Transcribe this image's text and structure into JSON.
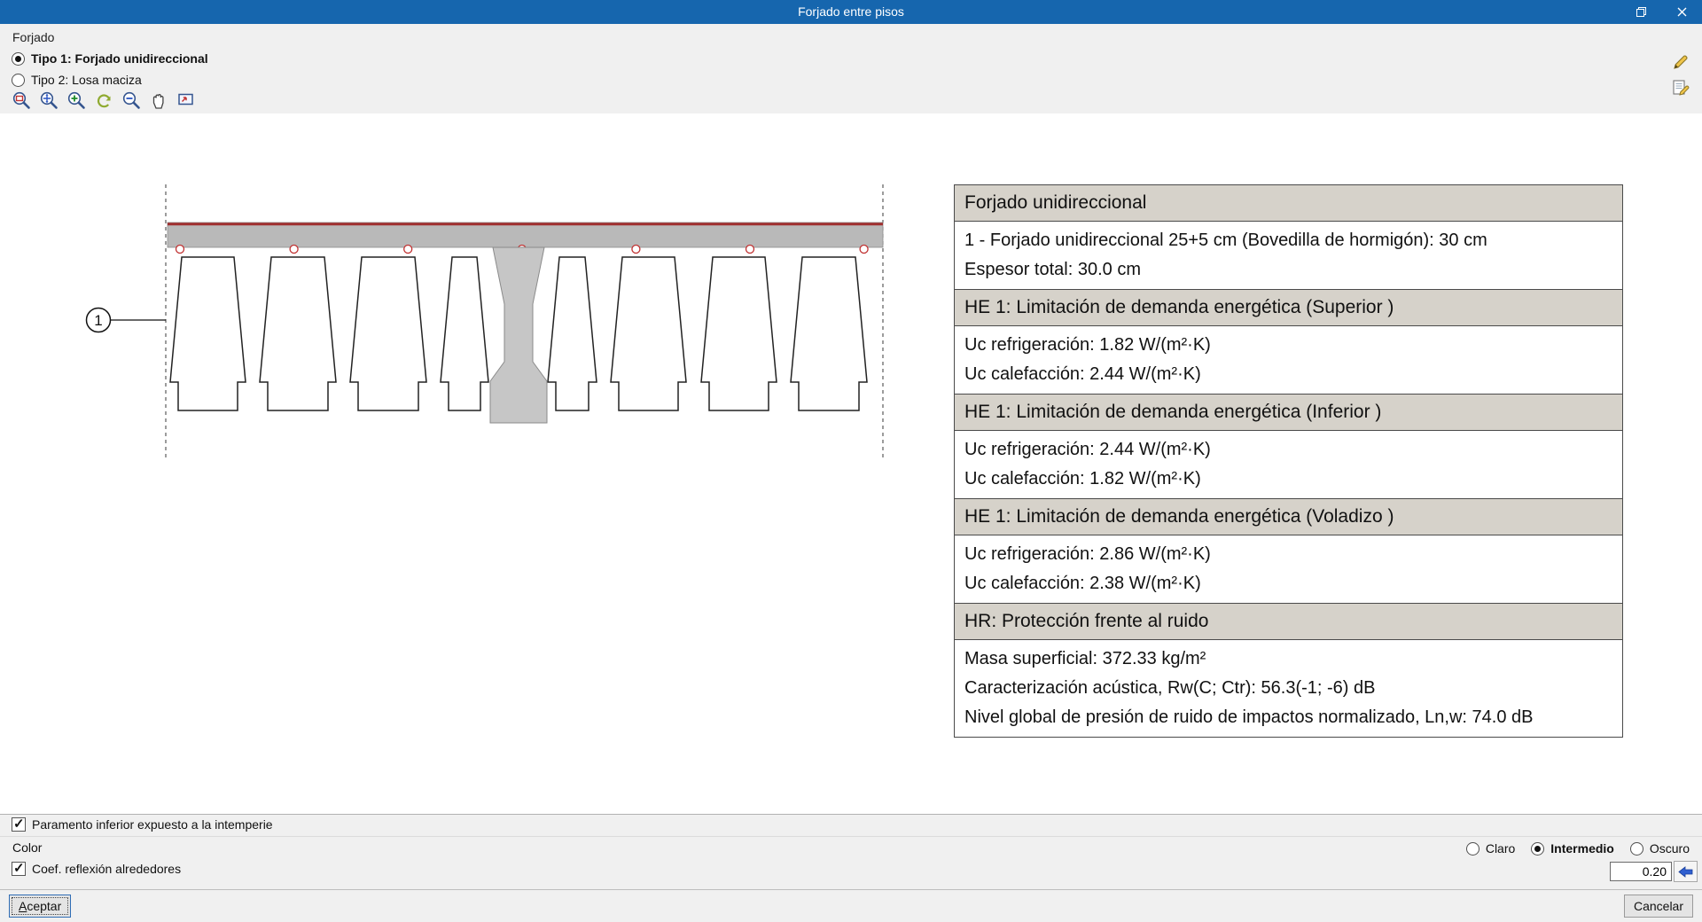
{
  "window": {
    "title": "Forjado entre pisos"
  },
  "titlebar": {
    "controls": [
      {
        "icon": "restore-icon"
      },
      {
        "icon": "close-icon"
      }
    ]
  },
  "top_panel": {
    "group_label": "Forjado",
    "options": [
      {
        "label": "Tipo 1: Forjado unidireccional",
        "selected": true
      },
      {
        "label": "Tipo 2: Losa maciza",
        "selected": false
      }
    ],
    "edit_buttons": [
      {
        "icon": "pencil-icon"
      },
      {
        "icon": "pencil-paper-icon"
      }
    ]
  },
  "toolbar": {
    "icons": [
      "zoom-window-icon",
      "zoom-extents-icon",
      "zoom-in-icon",
      "redraw-icon",
      "zoom-previous-icon",
      "pan-icon",
      "fit-view-icon"
    ]
  },
  "drawing": {
    "callout_label": "1"
  },
  "info_table": {
    "sections": [
      {
        "header": "Forjado unidireccional",
        "lines": [
          "1 - Forjado unidireccional 25+5 cm (Bovedilla de hormigón): 30 cm",
          "Espesor total: 30.0 cm"
        ]
      },
      {
        "header": "HE 1: Limitación de demanda energética (Superior )",
        "lines": [
          "Uc refrigeración: 1.82 W/(m²·K)",
          "Uc calefacción: 2.44 W/(m²·K)"
        ]
      },
      {
        "header": "HE 1: Limitación de demanda energética (Inferior )",
        "lines": [
          "Uc refrigeración: 2.44 W/(m²·K)",
          "Uc calefacción: 1.82 W/(m²·K)"
        ]
      },
      {
        "header": "HE 1: Limitación de demanda energética (Voladizo )",
        "lines": [
          "Uc refrigeración: 2.86 W/(m²·K)",
          "Uc calefacción: 2.38 W/(m²·K)"
        ]
      },
      {
        "header": "HR: Protección frente al ruido",
        "lines": [
          "Masa superficial: 372.33 kg/m²",
          "Caracterización acústica, Rw(C; Ctr): 56.3(-1; -6) dB",
          "Nivel global de presión de ruido de impactos normalizado, Ln,w: 74.0 dB"
        ]
      }
    ]
  },
  "bottom_panel": {
    "exposure_checkbox": {
      "label": "Paramento inferior expuesto a la intemperie",
      "checked": true
    },
    "color_label": "Color",
    "color_options": [
      {
        "label": "Claro",
        "selected": false
      },
      {
        "label": "Intermedio",
        "selected": true
      },
      {
        "label": "Oscuro",
        "selected": false
      }
    ],
    "reflection_checkbox": {
      "label": "Coef. reflexión alrededores",
      "checked": true
    },
    "reflection_value": "0.20"
  },
  "footer": {
    "accept_label": "Aceptar",
    "cancel_label": "Cancelar"
  },
  "colors": {
    "titlebar": "#1666ae",
    "table_header": "#d6d2ca",
    "accent_blue": "#2f5fd0",
    "rebar_red": "#c03030"
  }
}
